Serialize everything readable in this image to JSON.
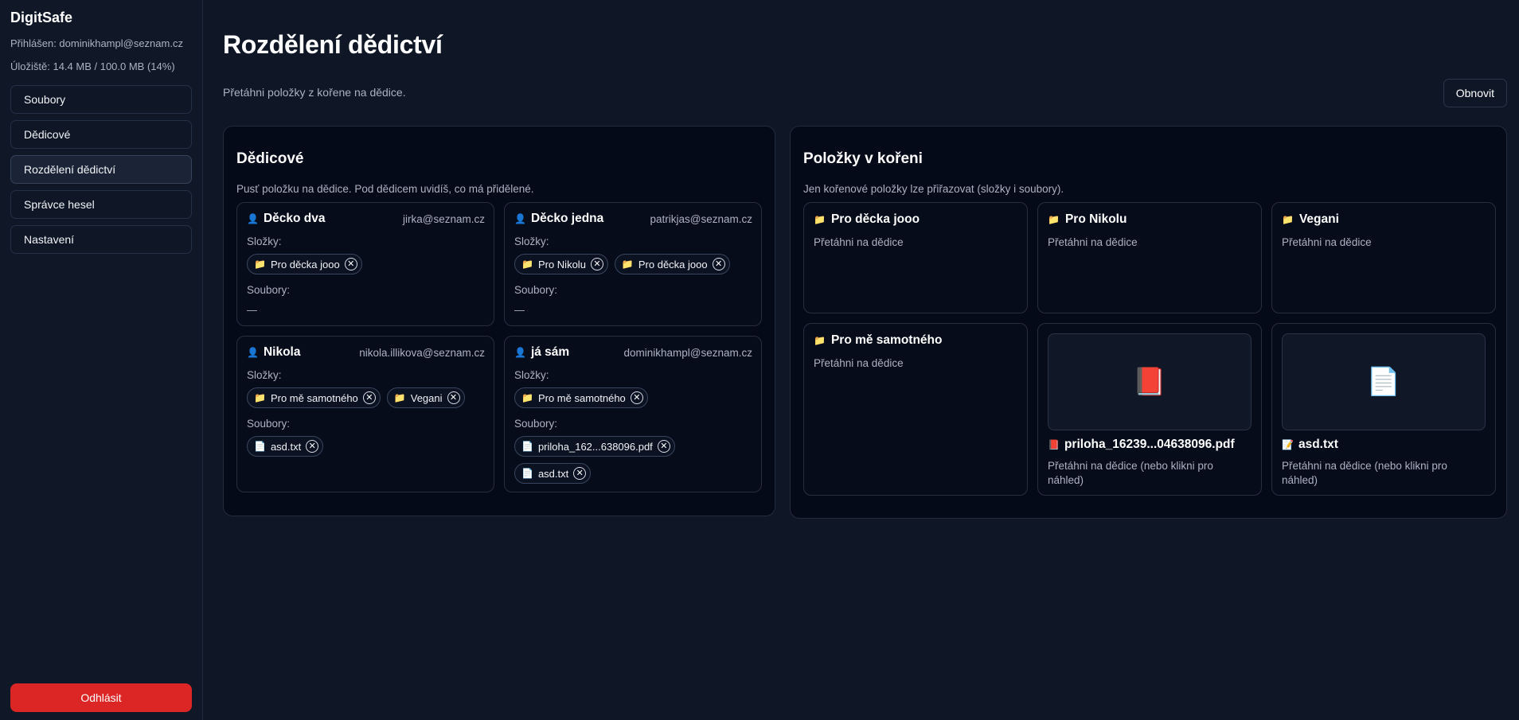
{
  "sidebar": {
    "brand": "DigitSafe",
    "logged_in": "Přihlášen: dominikhampl@seznam.cz",
    "storage": "Úložiště: 14.4 MB / 100.0 MB (14%)",
    "items": [
      {
        "label": "Soubory"
      },
      {
        "label": "Dědicové"
      },
      {
        "label": "Rozdělení dědictví"
      },
      {
        "label": "Správce hesel"
      },
      {
        "label": "Nastavení"
      }
    ],
    "active_index": 2,
    "logout_label": "Odhlásit"
  },
  "main": {
    "title": "Rozdělení dědictví",
    "subtitle": "Přetáhni položky z kořene na dědice.",
    "refresh_label": "Obnovit"
  },
  "heirs_panel": {
    "title": "Dědicové",
    "desc": "Pusť položku na dědice. Pod dědicem uvidíš, co má přidělené.",
    "folders_label": "Složky:",
    "files_label": "Soubory:",
    "empty": "—",
    "heirs": [
      {
        "name": "Děcko dva",
        "email": "jirka@seznam.cz",
        "folders": [
          "Pro děcka jooo"
        ],
        "files": []
      },
      {
        "name": "Děcko jedna",
        "email": "patrikjas@seznam.cz",
        "folders": [
          "Pro Nikolu",
          "Pro děcka jooo"
        ],
        "files": []
      },
      {
        "name": "Nikola",
        "email": "nikola.illikova@seznam.cz",
        "folders": [
          "Pro mě samotného",
          "Vegani"
        ],
        "files": [
          "asd.txt"
        ]
      },
      {
        "name": "já sám",
        "email": "dominikhampl@seznam.cz",
        "folders": [
          "Pro mě samotného"
        ],
        "files": [
          "priloha_162...638096.pdf",
          "asd.txt"
        ]
      }
    ]
  },
  "root_panel": {
    "title": "Položky v kořeni",
    "desc": "Jen kořenové položky lze přiřazovat (složky i soubory).",
    "folders": [
      {
        "name": "Pro děcka jooo",
        "hint": "Přetáhni na dědice"
      },
      {
        "name": "Pro Nikolu",
        "hint": "Přetáhni na dědice"
      },
      {
        "name": "Vegani",
        "hint": "Přetáhni na dědice"
      },
      {
        "name": "Pro mě samotného",
        "hint": "Přetáhni na dědice"
      }
    ],
    "files": [
      {
        "name": "priloha_16239...04638096.pdf",
        "hint": "Přetáhni na dědice (nebo klikni pro náhled)",
        "icon": "book-icon"
      },
      {
        "name": "asd.txt",
        "hint": "Přetáhni na dědice (nebo klikni pro náhled)",
        "icon": "document-icon"
      }
    ]
  },
  "colors": {
    "accent_danger": "#dc2626",
    "background": "#0f1626",
    "panel": "#050a18"
  }
}
